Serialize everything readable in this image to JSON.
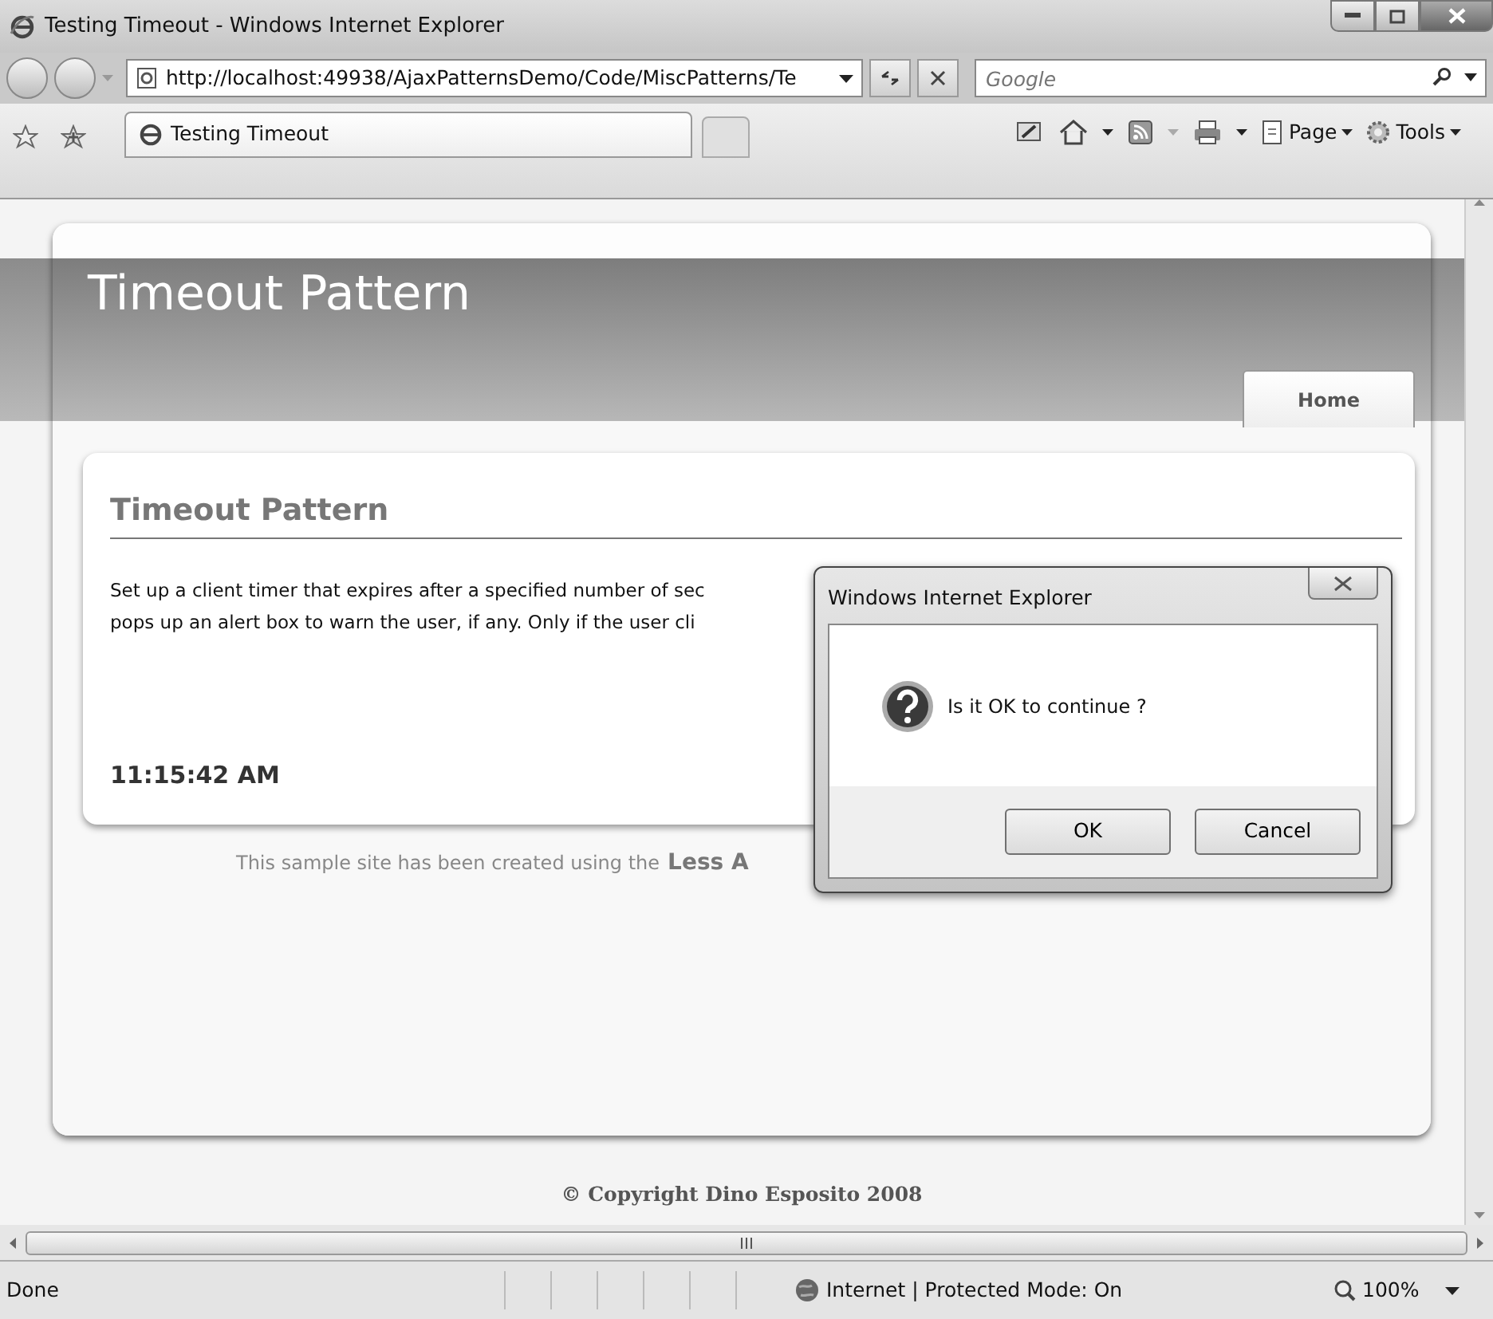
{
  "window": {
    "title": "Testing Timeout - Windows Internet Explorer"
  },
  "address_bar": {
    "url": "http://localhost:49938/AjaxPatternsDemo/Code/MiscPatterns/Te"
  },
  "search": {
    "placeholder": "Google"
  },
  "tabs": [
    {
      "label": "Testing Timeout",
      "selected": true
    }
  ],
  "command_bar": [
    {
      "label": "Page"
    },
    {
      "label": "Tools"
    }
  ],
  "page": {
    "title": "Timeout Pattern",
    "nav": [
      {
        "label": "Home",
        "selected": true
      }
    ],
    "heading": "Timeout Pattern",
    "paragraph_lines": [
      "Set up a client timer that expires after a specified number of sec",
      "pops up an alert box to warn the user, if any. Only if the user cli"
    ],
    "time": "11:15:42 AM",
    "credit": "This sample site has been created using the",
    "credit_link": "Less A",
    "copyright": "© Copyright Dino Esposito 2008"
  },
  "dialog": {
    "title": "Windows Internet Explorer",
    "message": "Is it OK to continue ?",
    "buttons": [
      "OK",
      "Cancel"
    ]
  },
  "status_bar": {
    "text": "Done",
    "zone": "Internet | Protected Mode: On",
    "zoom": "100%"
  }
}
